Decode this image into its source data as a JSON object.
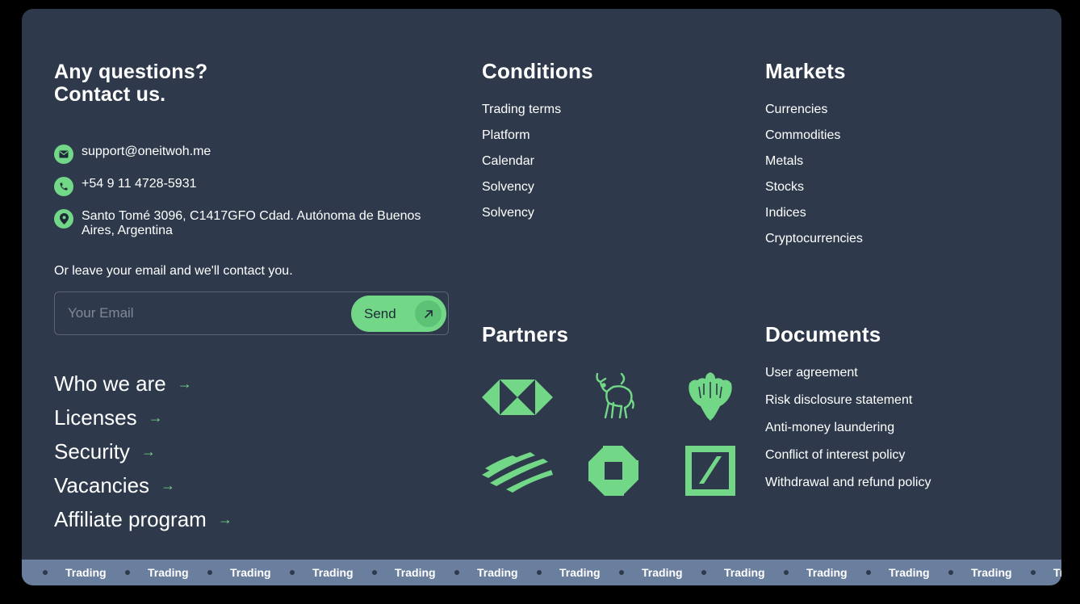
{
  "contact": {
    "heading_line1": "Any questions?",
    "heading_line2": "Contact us.",
    "email": "support@oneitwoh.me",
    "phone": "+54 9 11 4728-5931",
    "address": "Santo Tomé 3096, C1417GFO Cdad. Autónoma de Buenos Aires, Argentina",
    "leave_text": "Or leave your email and we'll contact you.",
    "email_placeholder": "Your Email",
    "send_label": "Send"
  },
  "nav_links": [
    {
      "label": "Who we are"
    },
    {
      "label": "Licenses"
    },
    {
      "label": "Security"
    },
    {
      "label": "Vacancies"
    },
    {
      "label": "Affiliate program"
    }
  ],
  "conditions": {
    "title": "Conditions",
    "items": [
      "Trading terms",
      "Platform",
      "Calendar",
      "Solvency",
      "Solvency"
    ]
  },
  "markets": {
    "title": "Markets",
    "items": [
      "Currencies",
      "Commodities",
      "Metals",
      "Stocks",
      "Indices",
      "Cryptocurrencies"
    ]
  },
  "partners": {
    "title": "Partners",
    "logos": [
      "hsbc-logo",
      "merrill-bull-logo",
      "barclays-eagle-logo",
      "bank-of-america-logo",
      "chase-logo",
      "deutsche-bank-logo"
    ]
  },
  "documents": {
    "title": "Documents",
    "items": [
      "User agreement",
      "Risk disclosure statement",
      "Anti-money laundering",
      "Conflict of interest policy",
      "Withdrawal and refund policy"
    ]
  },
  "ticker": {
    "item_label": "Trading",
    "items": [
      "Trading",
      "Trading",
      "Trading",
      "Trading",
      "Trading",
      "Trading",
      "Trading",
      "Trading",
      "Trading",
      "Trading",
      "Trading",
      "Trading",
      "Trading"
    ]
  },
  "colors": {
    "accent": "#72d887",
    "card_bg": "#2e3a4b",
    "ticker_bg": "#6a7f9e",
    "page_bg": "#000000"
  }
}
